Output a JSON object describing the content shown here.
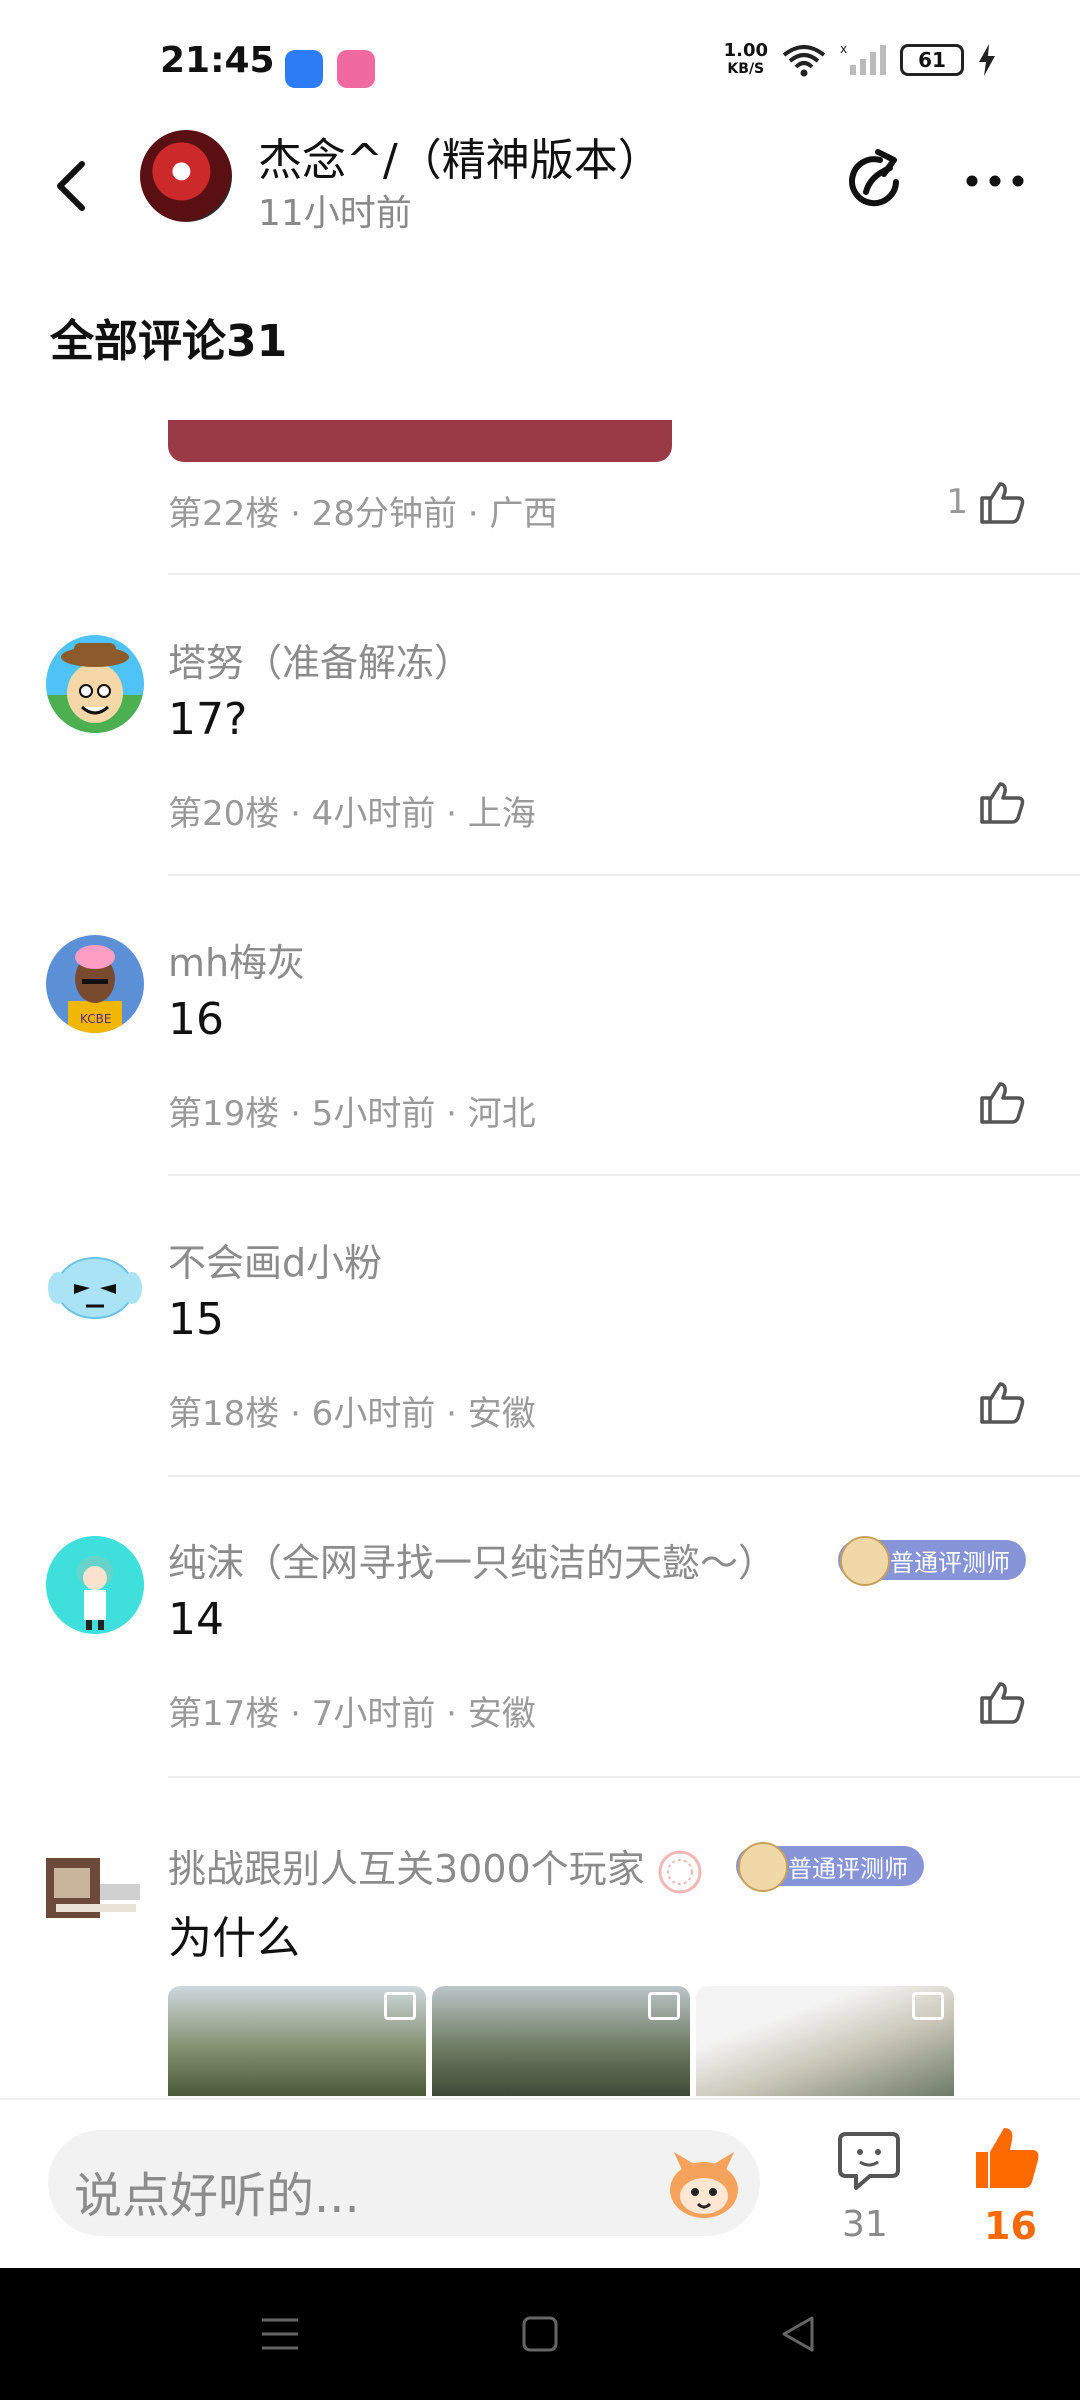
{
  "status_bar": {
    "time": "21:45",
    "net_speed_value": "1.00",
    "net_speed_unit": "KB/S",
    "battery": "61"
  },
  "header": {
    "title": "杰念^/（精神版本）",
    "subtitle": "11小时前"
  },
  "section": {
    "title": "全部评论31"
  },
  "comments": [
    {
      "meta": "第22楼 · 28分钟前 · 广西",
      "likes": "1"
    },
    {
      "name": "塔努（准备解冻）",
      "text": "17?",
      "meta": "第20楼 · 4小时前 · 上海"
    },
    {
      "name": "mh梅灰",
      "text": "16",
      "meta": "第19楼 · 5小时前 · 河北"
    },
    {
      "name": "不会画d小粉",
      "text": "15",
      "meta": "第18楼 · 6小时前 · 安徽"
    },
    {
      "name": "纯沫（全网寻找一只纯洁的天懿～）",
      "badge": "普通评测师",
      "text": "14",
      "meta": "第17楼 · 7小时前 · 安徽"
    },
    {
      "name": "挑战跟别人互关3000个玩家",
      "badge": "普通评测师",
      "text": "为什么"
    }
  ],
  "bottom_bar": {
    "input_placeholder": "说点好听的...",
    "comment_count": "31",
    "like_count": "16"
  },
  "colors": {
    "accent_orange": "#ff6a00",
    "badge_purple": "#8794d8",
    "meta_gray": "#9a9a9a"
  },
  "icons": [
    "back-arrow-icon",
    "share-icon",
    "more-icon",
    "thumbs-up-icon",
    "comment-icon",
    "emoji-icon",
    "menu-icon",
    "home-icon",
    "back-triangle-icon"
  ]
}
